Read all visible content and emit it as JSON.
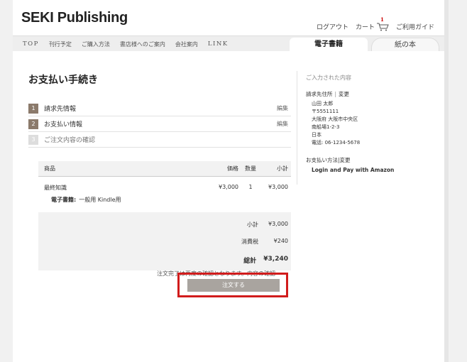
{
  "header": {
    "logo": "SEKI Publishing",
    "links": {
      "logout": "ログアウト",
      "cart": "カート",
      "cart_count": "1",
      "guide": "ご利用ガイド"
    }
  },
  "nav": {
    "items": [
      "TOP",
      "刊行予定",
      "ご購入方法",
      "書店様へのご案内",
      "会社案内",
      "LINK"
    ],
    "tabs": {
      "ebook": "電子書籍",
      "paper": "紙の本"
    }
  },
  "main": {
    "title": "お支払い手続き",
    "steps": [
      {
        "num": "1",
        "label": "請求先情報",
        "edit": "編集"
      },
      {
        "num": "2",
        "label": "お支払い情報",
        "edit": "編集"
      },
      {
        "num": "3",
        "label": "ご注文内容の確認"
      }
    ],
    "order": {
      "headers": {
        "item": "商品",
        "price": "価格",
        "qty": "数量",
        "subtotal": "小計"
      },
      "item": {
        "name": "最終知識",
        "price": "¥3,000",
        "qty": "1",
        "subtotal": "¥3,000",
        "format_label": "電子書籍:",
        "format_value": "一般用 Kindle用"
      },
      "totals": {
        "subtotal_label": "小計",
        "subtotal": "¥3,000",
        "tax_label": "消費税",
        "tax": "¥240",
        "total_label": "総計",
        "total": "¥3,240"
      }
    },
    "note": "注文完了は再度の確認となります。内容の確認",
    "order_button": "注文する"
  },
  "sidebar": {
    "title": "ご入力された内容",
    "billing": {
      "label": "請求先住所",
      "sep": "|",
      "edit": "変更"
    },
    "address": [
      "山田 太郎",
      "〒5551111",
      "大阪府 大阪市中央区",
      "南船場1-2-3",
      "日本",
      "電話: 06-1234-5678"
    ],
    "payment": {
      "label": "お支払い方法",
      "sep": "|",
      "edit": "変更",
      "method": "Login and Pay with Amazon"
    }
  },
  "colors": {
    "step_active": "#8b7a6b",
    "highlight": "#d11c1c",
    "button": "#a9a49f"
  }
}
